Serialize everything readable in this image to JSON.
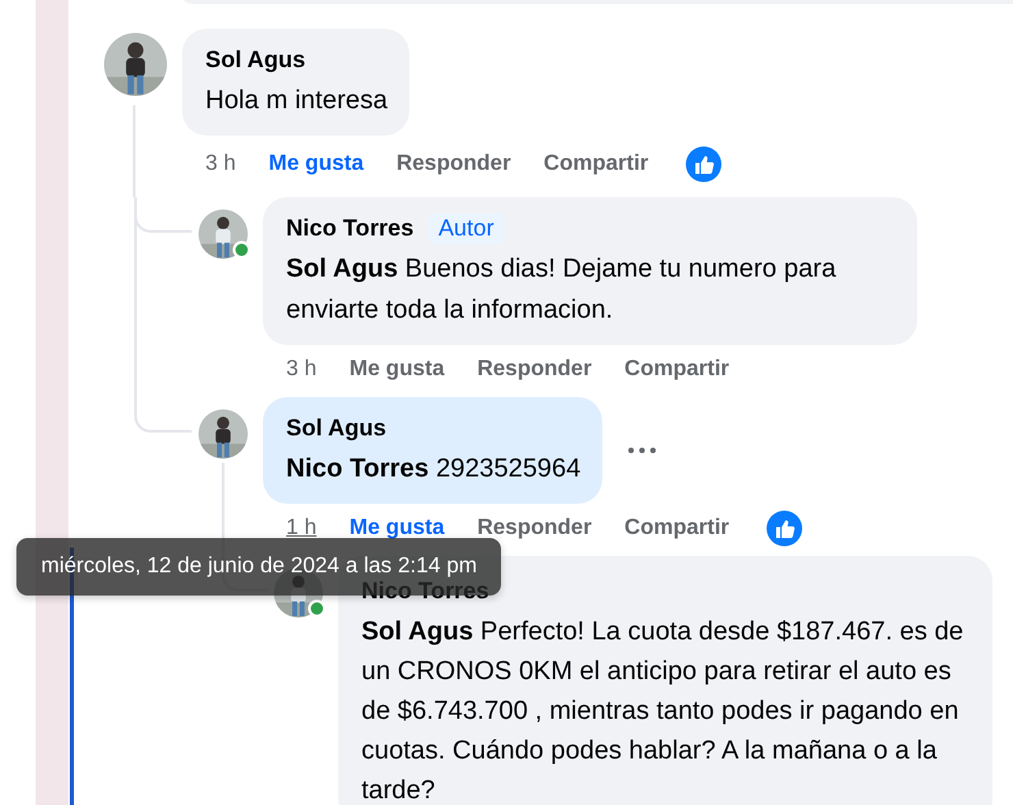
{
  "comments": [
    {
      "author": "Sol Agus",
      "text": "Hola m interesa",
      "time": "3 h",
      "time_hovered": false,
      "like": "Me gusta",
      "reply": "Responder",
      "share": "Compartir",
      "liked": true,
      "reaction": true,
      "online": false,
      "highlighted": false,
      "more_menu": false,
      "children": [
        {
          "author": "Nico Torres",
          "badge": "Autor",
          "mention": "Sol Agus",
          "text": "Buenos dias! Dejame tu numero para enviarte toda la informacion.",
          "time": "3 h",
          "time_hovered": false,
          "like": "Me gusta",
          "reply": "Responder",
          "share": "Compartir",
          "liked": false,
          "reaction": false,
          "online": true,
          "highlighted": false,
          "more_menu": false
        },
        {
          "author": "Sol Agus",
          "mention": "Nico Torres",
          "text": "2923525964",
          "time": "1 h",
          "time_hovered": true,
          "like": "Me gusta",
          "reply": "Responder",
          "share": "Compartir",
          "liked": true,
          "reaction": true,
          "online": false,
          "highlighted": true,
          "more_menu": true,
          "children": [
            {
              "author": "Nico Torres",
              "mention": "Sol Agus",
              "text": "Perfecto! La cuota desde $187.467. es de un CRONOS 0KM el anticipo para retirar el auto es de $6.743.700 , mientras tanto podes ir pagando en cuotas. Cuándo podes hablar? A la mañana o a la tarde?",
              "online": true,
              "highlighted": false,
              "more_menu": false
            }
          ]
        }
      ]
    }
  ],
  "tooltip": {
    "text": "miércoles, 12 de junio de 2024 a las 2:14 pm"
  }
}
